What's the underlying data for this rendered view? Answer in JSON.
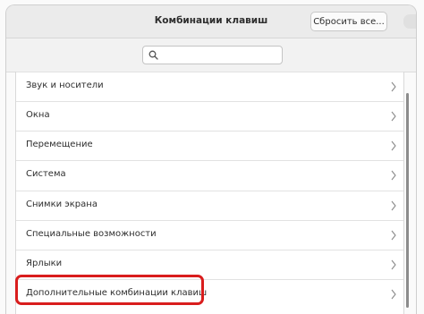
{
  "header": {
    "title": "Комбинации клавиш",
    "reset_label": "Сбросить все..."
  },
  "search": {
    "value": "",
    "placeholder": "",
    "icon": "search-icon"
  },
  "list": {
    "items": [
      {
        "label": "Звук и носители",
        "icon": "chevron-right-icon"
      },
      {
        "label": "Окна",
        "icon": "chevron-right-icon"
      },
      {
        "label": "Перемещение",
        "icon": "chevron-right-icon"
      },
      {
        "label": "Система",
        "icon": "chevron-right-icon"
      },
      {
        "label": "Снимки экрана",
        "icon": "chevron-right-icon"
      },
      {
        "label": "Специальные возможности",
        "icon": "chevron-right-icon"
      },
      {
        "label": "Ярлыки",
        "icon": "chevron-right-icon"
      },
      {
        "label": "Дополнительные комбинации клавиш",
        "icon": "chevron-right-icon"
      }
    ]
  },
  "colors": {
    "highlight": "#d91d1d",
    "headerbar": "#ebebeb"
  }
}
